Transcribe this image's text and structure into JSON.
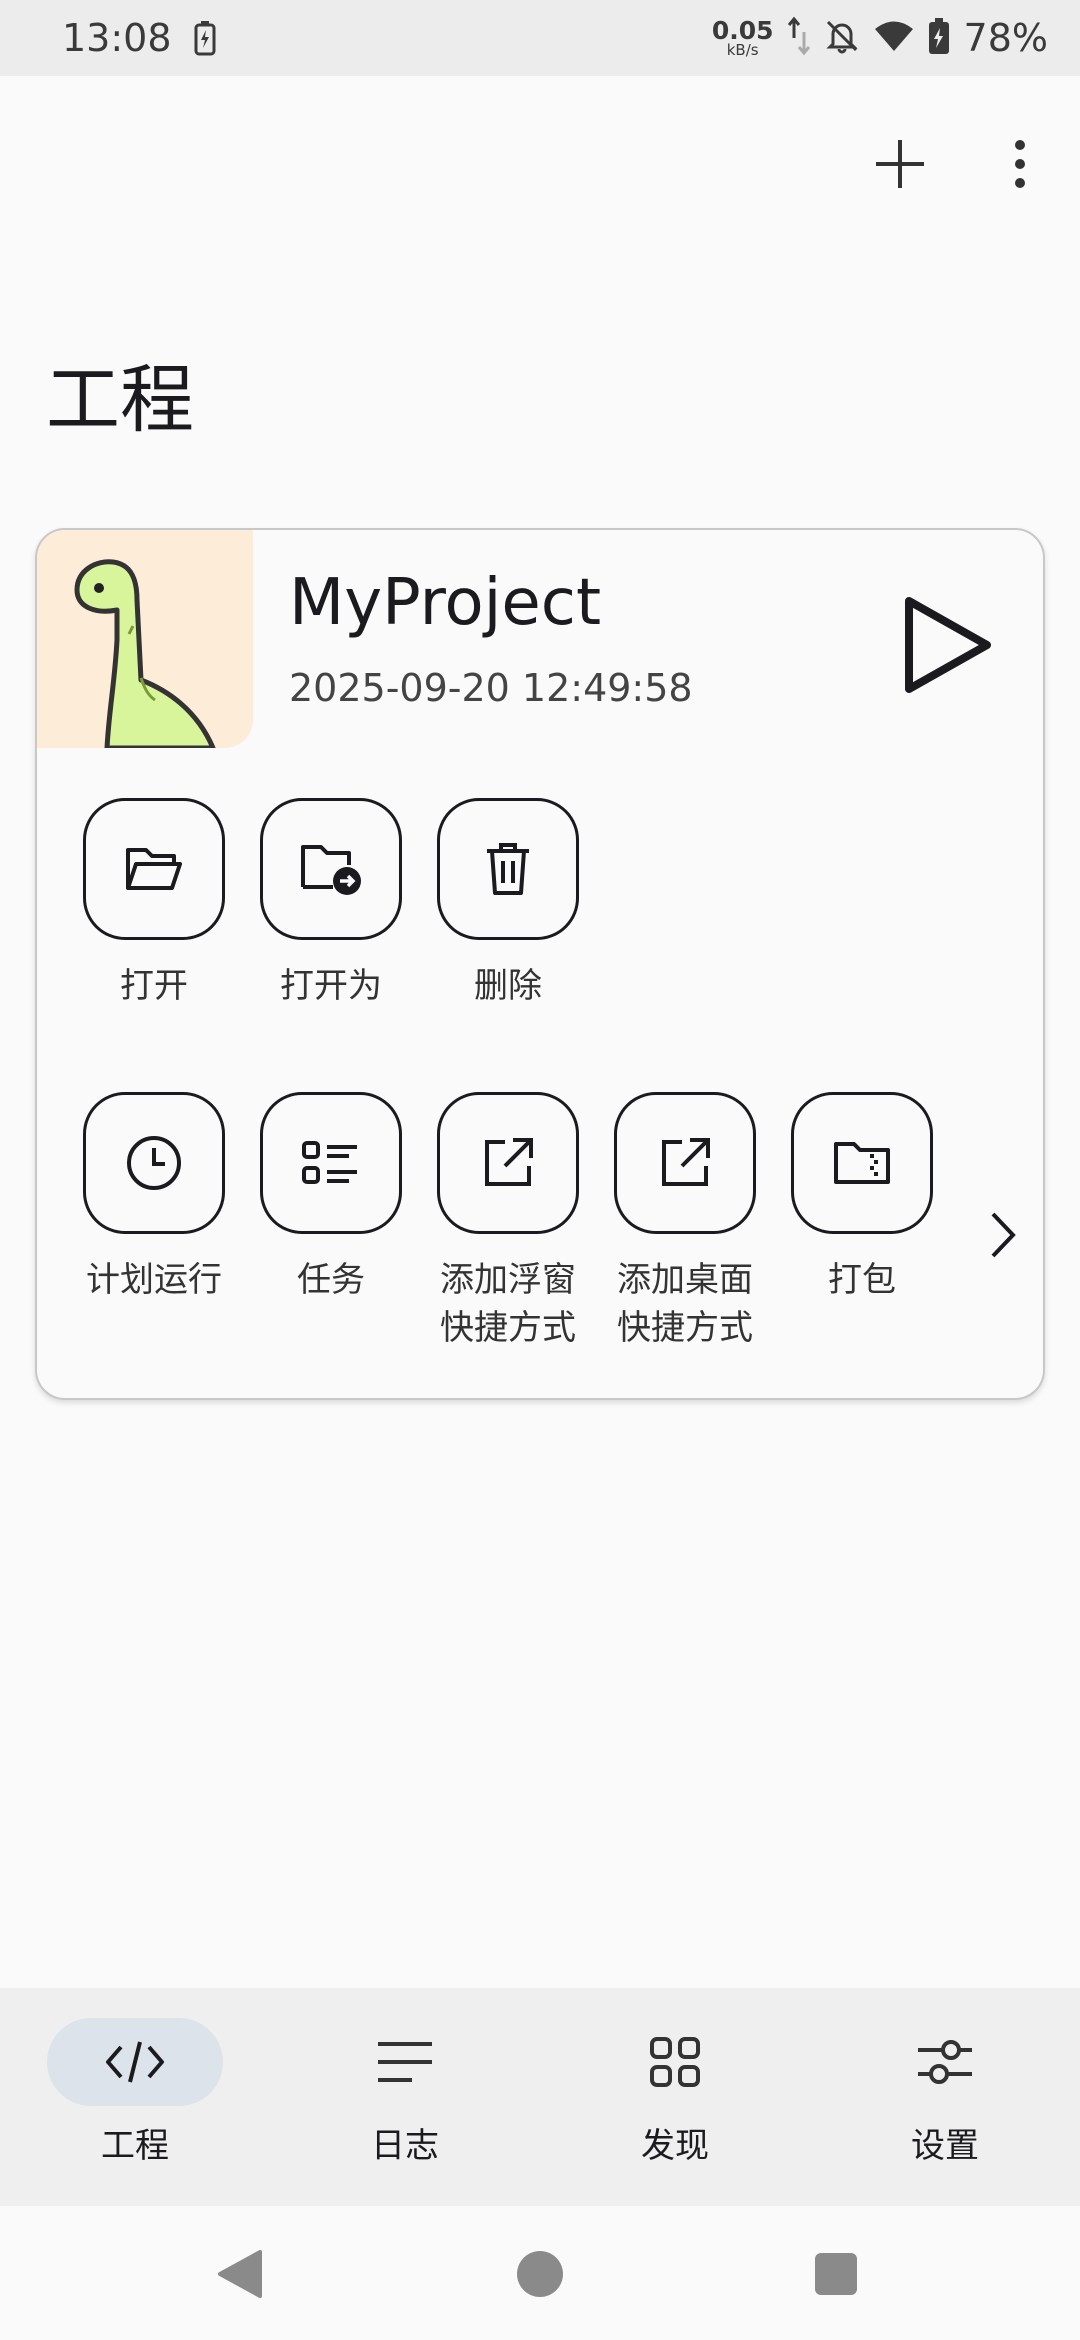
{
  "status_bar": {
    "time": "13:08",
    "net_speed_value": "0.05",
    "net_speed_unit": "kB/s",
    "battery_percent": "78%",
    "icons": [
      "battery-saver-icon",
      "data-arrows-icon",
      "bell-off-icon",
      "wifi-icon",
      "battery-charging-icon"
    ]
  },
  "toolbar": {
    "add_icon": "plus-icon",
    "more_icon": "more-vertical-icon"
  },
  "page": {
    "title": "工程"
  },
  "project": {
    "name": "MyProject",
    "date": "2025-09-20 12:49:58",
    "thumb_bg": "#fdecd8",
    "mascot_color": "#d8f59c"
  },
  "actions_row1": [
    {
      "label": "打开",
      "icon": "folder-open-icon"
    },
    {
      "label": "打开为",
      "icon": "folder-arrow-icon"
    },
    {
      "label": "删除",
      "icon": "trash-icon"
    }
  ],
  "actions_row2": [
    {
      "label": "计划运行",
      "icon": "clock-icon"
    },
    {
      "label": "任务",
      "icon": "task-list-icon"
    },
    {
      "label": "添加浮窗\n快捷方式",
      "icon": "external-link-icon"
    },
    {
      "label": "添加桌面\n快捷方式",
      "icon": "external-link-icon"
    },
    {
      "label": "打包",
      "icon": "folder-zip-icon"
    }
  ],
  "bottom_nav": [
    {
      "label": "工程",
      "icon": "code-icon",
      "active": true
    },
    {
      "label": "日志",
      "icon": "lines-icon",
      "active": false
    },
    {
      "label": "发现",
      "icon": "grid-icon",
      "active": false
    },
    {
      "label": "设置",
      "icon": "sliders-icon",
      "active": false
    }
  ],
  "colors": {
    "background": "#fafafa",
    "nav_active_pill": "#dde3ea",
    "status_bar": "#ececec",
    "bottom_nav": "#efefef"
  }
}
